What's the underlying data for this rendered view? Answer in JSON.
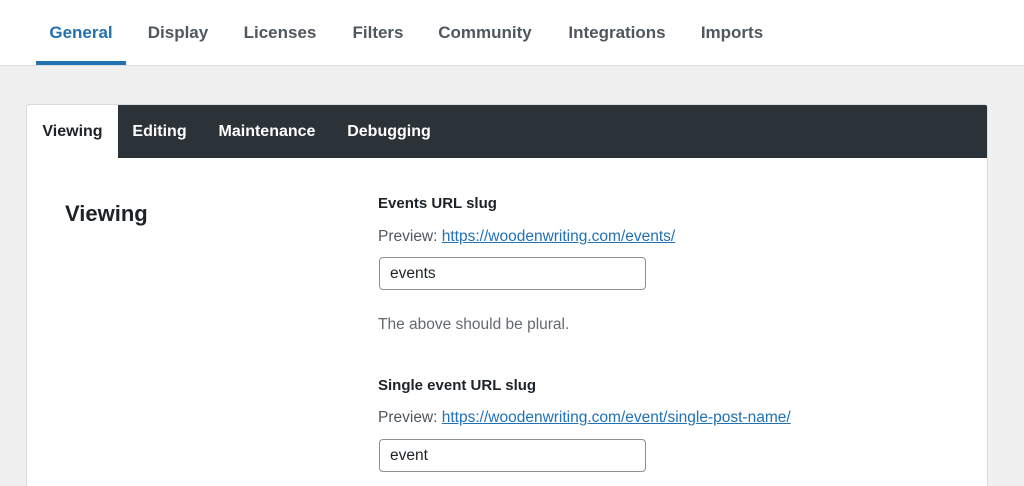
{
  "top_tabs": [
    {
      "label": "General",
      "active": true
    },
    {
      "label": "Display",
      "active": false
    },
    {
      "label": "Licenses",
      "active": false
    },
    {
      "label": "Filters",
      "active": false
    },
    {
      "label": "Community",
      "active": false
    },
    {
      "label": "Integrations",
      "active": false
    },
    {
      "label": "Imports",
      "active": false
    }
  ],
  "sub_tabs": [
    {
      "label": "Viewing",
      "active": true
    },
    {
      "label": "Editing",
      "active": false
    },
    {
      "label": "Maintenance",
      "active": false
    },
    {
      "label": "Debugging",
      "active": false
    }
  ],
  "section": {
    "title": "Viewing"
  },
  "fields": [
    {
      "label": "Events URL slug",
      "preview_prefix": "Preview:",
      "preview_url": "https://woodenwriting.com/events/",
      "value": "events",
      "help": "The above should be plural."
    },
    {
      "label": "Single event URL slug",
      "preview_prefix": "Preview:",
      "preview_url": "https://woodenwriting.com/event/single-post-name/",
      "value": "event"
    }
  ],
  "colors": {
    "accent": "#2271b1",
    "subnav_background": "#2c3338",
    "page_background": "#f0f0f1"
  }
}
